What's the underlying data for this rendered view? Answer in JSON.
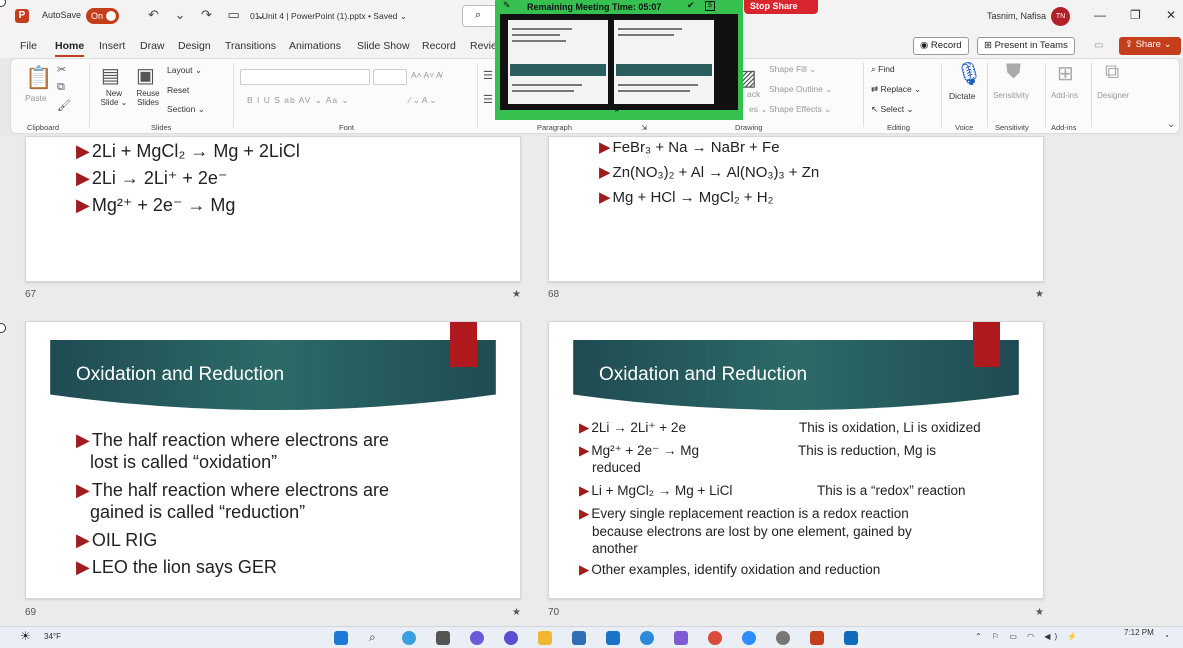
{
  "titlebar": {
    "app_logo": "P",
    "autosave_label": "AutoSave",
    "autosave_state": "On",
    "quick_access": "↶ ⌄ ↷ ▭ ⌄",
    "document_title": "01 Unit 4 | PowerPoint (1).pptx • Saved ⌄",
    "search_icon": "⌕",
    "user_name": "Tasnim, Nafisa",
    "user_initials": "TN",
    "minimize": "—",
    "restore": "❐",
    "close": "✕"
  },
  "menu": {
    "tabs": [
      "File",
      "Home",
      "Insert",
      "Draw",
      "Design",
      "Transitions",
      "Animations",
      "Slide Show",
      "Record",
      "Revie"
    ],
    "active": "Home",
    "record_button": "◉ Record",
    "teams_button": "⊞ Present in Teams",
    "share_button": "⇪ Share ⌄"
  },
  "ribbon": {
    "clipboard": {
      "paste": "Paste",
      "label": "Clipboard"
    },
    "slides": {
      "new_slide": "New Slide ⌄",
      "reuse_slides": "Reuse Slides",
      "layout": "Layout ⌄",
      "reset": "Reset",
      "section": "Section ⌄",
      "label": "Slides"
    },
    "font": {
      "label": "Font",
      "format_buttons": "B  I  U  S  ab  AV ⌄  Aa ⌄",
      "grow_shrink": "A˄  A˅  A̸"
    },
    "paragraph": {
      "label": "Paragraph"
    },
    "drawing": {
      "shape_fill": "Shape Fill ⌄",
      "shape_outline": "Shape Outline ⌄",
      "shape_effects": "Shape Effects ⌄",
      "label": "Drawing"
    },
    "editing": {
      "find": "Find",
      "replace": "Replace ⌄",
      "select": "Select ⌄",
      "label": "Editing"
    },
    "voice": {
      "dictate": "Dictate",
      "label": "Voice"
    },
    "sensitivity": {
      "button": "Sensitivity",
      "label": "Sensitivity"
    },
    "addins": {
      "button": "Add-ins",
      "label": "Add-ins"
    },
    "designer": {
      "button": "Designer"
    }
  },
  "meeting": {
    "remaining": "Remaining Meeting Time: 05:07",
    "stop_share": "Stop Share"
  },
  "slides": [
    {
      "number": "67",
      "bullets": [
        "2Li + MgCl₂ → Mg + 2LiCl",
        "2Li →  2Li⁺ + 2e⁻",
        "Mg²⁺ + 2e⁻ → Mg"
      ]
    },
    {
      "number": "68",
      "bullets": [
        "FeBr₃ + Na → NaBr + Fe",
        "Zn(NO₃)₂ + Al → Al(NO₃)₃ + Zn",
        "Mg + HCl → MgCl₂ + H₂"
      ]
    },
    {
      "number": "69",
      "title": "Oxidation and Reduction",
      "bullets": [
        "The half reaction where electrons are",
        "lost is called “oxidation”",
        "The half reaction where electrons are",
        "gained is called “reduction”",
        "OIL RIG",
        "LEO the lion says GER"
      ]
    },
    {
      "number": "70",
      "title": "Oxidation and Reduction",
      "rows": [
        {
          "left": "2Li →  2Li⁺ + 2e",
          "right": "This is oxidation, Li is oxidized"
        },
        {
          "left": "Mg²⁺ + 2e⁻ → Mg",
          "right": "This is reduction, Mg is",
          "cont": "reduced"
        },
        {
          "left": "Li + MgCl₂ → Mg + LiCl",
          "right": "This is a “redox” reaction"
        }
      ],
      "para": [
        "Every single replacement reaction is a redox reaction",
        "because electrons are lost by one element, gained by",
        "another"
      ],
      "last": "Other examples, identify oxidation and reduction"
    }
  ],
  "taskbar": {
    "weather": "34°F",
    "time": "7:12 PM"
  },
  "colors": {
    "accent": "#c43e1c",
    "banner": "#2a5f5e",
    "red_tab": "#b01a1f",
    "bullet": "#a01c1c"
  }
}
